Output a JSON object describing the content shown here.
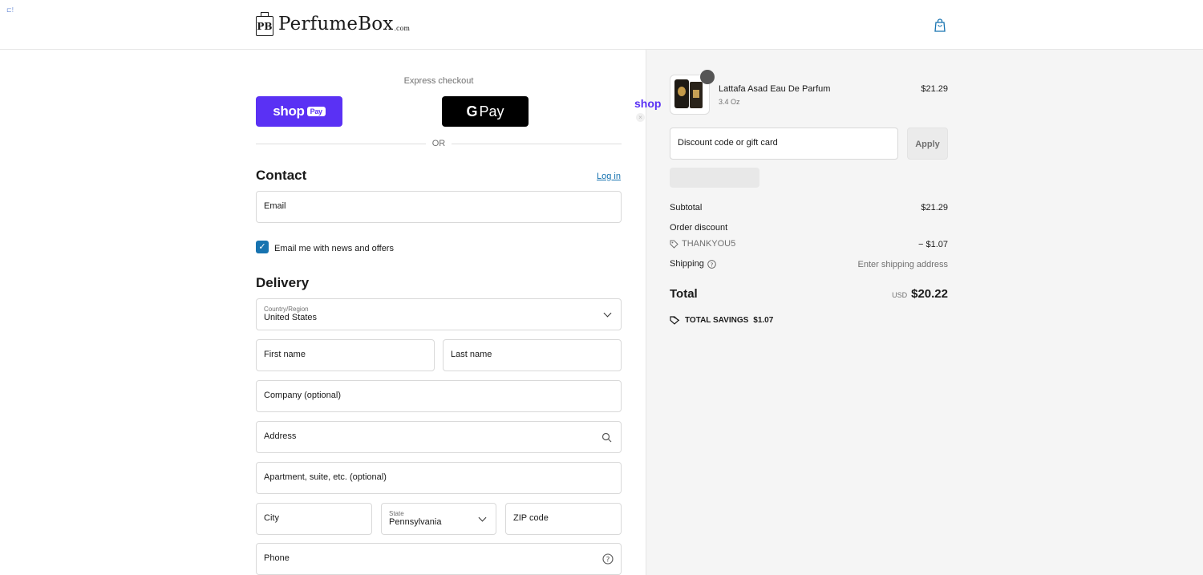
{
  "header": {
    "corner_mark": "⊏!",
    "logo_initials": "PB",
    "logo_name": "PerfumeBox",
    "logo_suffix": ".com"
  },
  "express": {
    "label": "Express checkout",
    "shop_pay_label": "shop",
    "shop_pay_pill": "Pay",
    "gpay_g": "G",
    "gpay_label": "Pay",
    "or_label": "OR",
    "shop_float": "shop",
    "float_close": "×"
  },
  "contact": {
    "heading": "Contact",
    "login_label": "Log in",
    "email_placeholder": "Email",
    "newsletter_label": "Email me with news and offers",
    "newsletter_checked": true
  },
  "delivery": {
    "heading": "Delivery",
    "country_label": "Country/Region",
    "country_value": "United States",
    "first_name_placeholder": "First name",
    "last_name_placeholder": "Last name",
    "company_placeholder": "Company (optional)",
    "address_placeholder": "Address",
    "apartment_placeholder": "Apartment, suite, etc. (optional)",
    "city_placeholder": "City",
    "state_label": "State",
    "state_value": "Pennsylvania",
    "zip_placeholder": "ZIP code",
    "phone_placeholder": "Phone"
  },
  "order": {
    "product": {
      "name": "Lattafa Asad Eau De Parfum",
      "variant": "3.4 Oz",
      "price": "$21.29",
      "quantity": ""
    },
    "discount_placeholder": "Discount code or gift card",
    "apply_label": "Apply",
    "subtotal_label": "Subtotal",
    "subtotal_value": "$21.29",
    "order_discount_label": "Order discount",
    "discount_code": "THANKYOU5",
    "discount_value": "− $1.07",
    "shipping_label": "Shipping",
    "shipping_value": "Enter shipping address",
    "total_label": "Total",
    "total_currency": "USD",
    "total_value": "$20.22",
    "savings_label": "TOTAL SAVINGS",
    "savings_value": "$1.07"
  },
  "colors": {
    "shop_pay": "#5a31f4",
    "link": "#1773b0",
    "sidebar_bg": "#f5f5f5"
  }
}
